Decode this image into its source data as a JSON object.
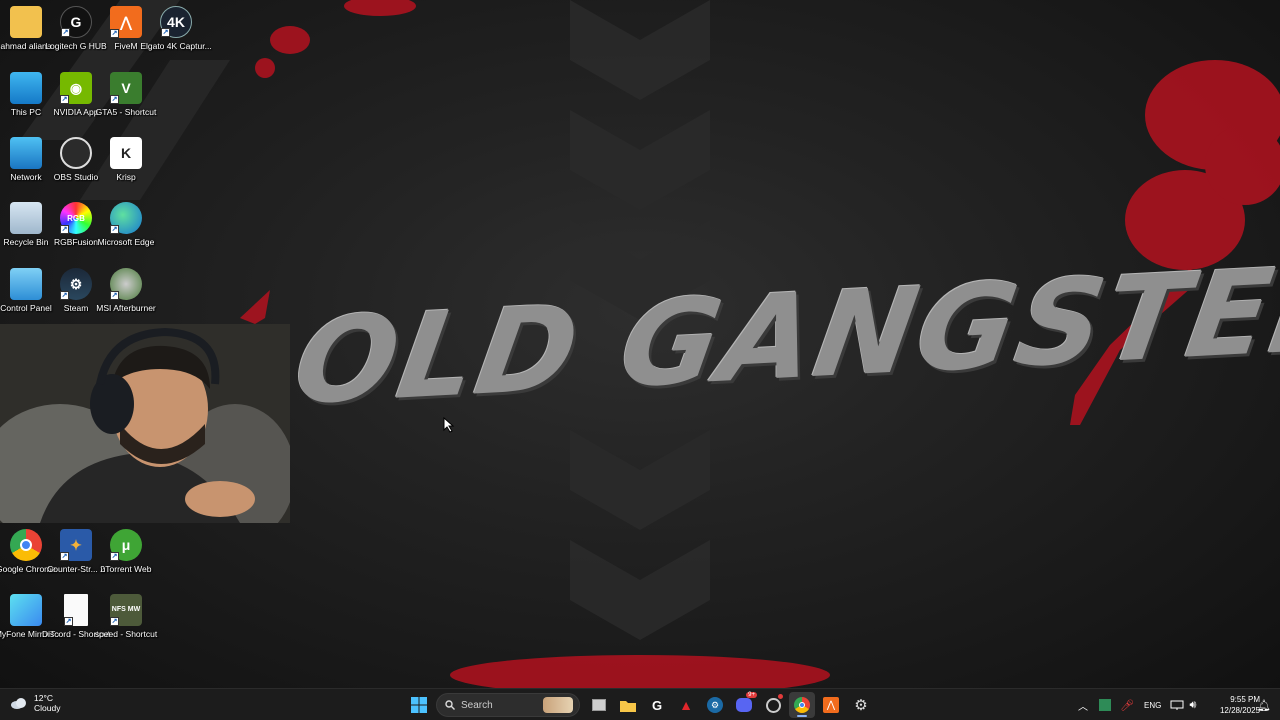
{
  "wallpaper": {
    "title": "OLD GANGSTER'S",
    "accent": "#b3121f"
  },
  "desktop": {
    "icons": [
      {
        "label": "ahmad aliana",
        "icon": "folder-icon"
      },
      {
        "label": "Logitech G HUB",
        "icon": "logitech-icon"
      },
      {
        "label": "FiveM",
        "icon": "fivem-icon"
      },
      {
        "label": "Elgato 4K Captur...",
        "icon": "elgato-icon",
        "badge": "4K"
      },
      {
        "label": "This PC",
        "icon": "monitor-icon"
      },
      {
        "label": "NVIDIA App",
        "icon": "nvidia-icon"
      },
      {
        "label": "GTA5 - Shortcut",
        "icon": "gta5-icon",
        "badge": "V"
      },
      {
        "label": "Network",
        "icon": "network-icon"
      },
      {
        "label": "OBS Studio",
        "icon": "obs-icon"
      },
      {
        "label": "Krisp",
        "icon": "krisp-icon",
        "badge": "K"
      },
      {
        "label": "Recycle Bin",
        "icon": "recycle-bin-icon"
      },
      {
        "label": "RGBFusion",
        "icon": "rgbfusion-icon",
        "badge": "RGB"
      },
      {
        "label": "Microsoft Edge",
        "icon": "edge-icon"
      },
      {
        "label": "Control Panel",
        "icon": "control-panel-icon"
      },
      {
        "label": "Steam",
        "icon": "steam-icon"
      },
      {
        "label": "MSI Afterburner",
        "icon": "msi-afterburner-icon"
      },
      {
        "label": "Google Chrome",
        "icon": "chrome-icon"
      },
      {
        "label": "Counter-Str... 2",
        "icon": "counter-strike-icon"
      },
      {
        "label": "uTorrent Web",
        "icon": "utorrent-icon"
      },
      {
        "label": "iMyFone MirrorTo",
        "icon": "imyfone-icon"
      },
      {
        "label": "Discord - Shortcut",
        "icon": "document-icon"
      },
      {
        "label": "speed - Shortcut",
        "icon": "nfs-icon",
        "badge": "NFS MW"
      }
    ]
  },
  "taskbar": {
    "weather": {
      "temp": "12°C",
      "condition": "Cloudy",
      "icon": "cloud-icon"
    },
    "search_label": "Search",
    "apps": [
      "windows-start-icon",
      "task-view-icon",
      "file-explorer-icon",
      "logitech-icon",
      "adobe-icon",
      "steam-icon",
      "discord-icon",
      "overwolf-icon",
      "chrome-icon",
      "fivem-icon",
      "settings-icon"
    ],
    "discord_badge": "9+",
    "language": "ENG",
    "time": "9:55 PM",
    "date": "12/28/2025"
  }
}
